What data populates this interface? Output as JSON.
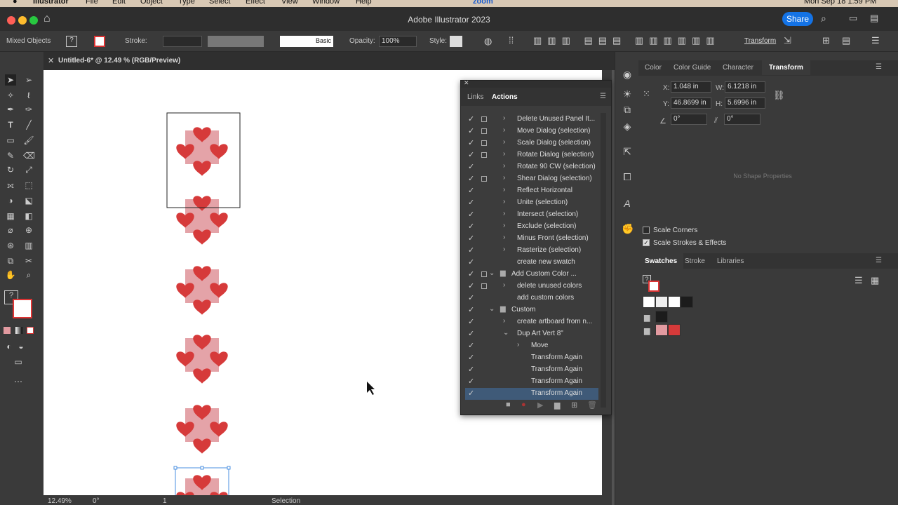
{
  "menubar": {
    "app": "Illustrator",
    "items": [
      "File",
      "Edit",
      "Object",
      "Type",
      "Select",
      "Effect",
      "View",
      "Window",
      "Help"
    ],
    "clock": "Mon Sep 18  1:59 PM",
    "zoom_app": "zoom"
  },
  "window": {
    "title": "Adobe Illustrator 2023",
    "share": "Share"
  },
  "control": {
    "selection": "Mixed Objects",
    "stroke_label": "Stroke:",
    "brush": "Basic",
    "opacity_label": "Opacity:",
    "opacity": "100%",
    "style_label": "Style:",
    "transform": "Transform"
  },
  "document": {
    "tab": "Untitled-6* @ 12.49 % (RGB/Preview)"
  },
  "status": {
    "zoom": "12.49%",
    "rotation": "0°",
    "artboard": "1",
    "tool": "Selection"
  },
  "actions_panel": {
    "tabs": [
      "Links",
      "Actions"
    ],
    "rows": [
      {
        "label": "Delete Unused Panel It...",
        "box": true,
        "indent": 1,
        "arrow": "›"
      },
      {
        "label": "Move Dialog (selection)",
        "box": true,
        "indent": 1,
        "arrow": "›"
      },
      {
        "label": "Scale Dialog (selection)",
        "box": true,
        "indent": 1,
        "arrow": "›"
      },
      {
        "label": "Rotate Dialog (selection)",
        "box": true,
        "indent": 1,
        "arrow": "›"
      },
      {
        "label": "Rotate 90 CW (selection)",
        "box": false,
        "indent": 1,
        "arrow": "›"
      },
      {
        "label": "Shear Dialog (selection)",
        "box": true,
        "indent": 1,
        "arrow": "›"
      },
      {
        "label": "Reflect Horizontal",
        "box": false,
        "indent": 1,
        "arrow": "›"
      },
      {
        "label": "Unite (selection)",
        "box": false,
        "indent": 1,
        "arrow": "›"
      },
      {
        "label": "Intersect (selection)",
        "box": false,
        "indent": 1,
        "arrow": "›"
      },
      {
        "label": "Exclude (selection)",
        "box": false,
        "indent": 1,
        "arrow": "›"
      },
      {
        "label": "Minus Front (selection)",
        "box": false,
        "indent": 1,
        "arrow": "›"
      },
      {
        "label": "Rasterize (selection)",
        "box": false,
        "indent": 1,
        "arrow": "›"
      },
      {
        "label": "create new swatch",
        "box": false,
        "indent": 1,
        "arrow": ""
      },
      {
        "label": "Add Custom Color ...",
        "box": true,
        "indent": 0,
        "arrow": "⌄",
        "folder": true
      },
      {
        "label": "delete unused colors",
        "box": true,
        "indent": 1,
        "arrow": "›"
      },
      {
        "label": "add custom colors",
        "box": false,
        "indent": 1,
        "arrow": ""
      },
      {
        "label": "Custom",
        "box": false,
        "indent": 0,
        "arrow": "⌄",
        "folder": true
      },
      {
        "label": "create artboard from n...",
        "box": false,
        "indent": 1,
        "arrow": "›"
      },
      {
        "label": "Dup Art Vert 8\"",
        "box": false,
        "indent": 1,
        "arrow": "⌄"
      },
      {
        "label": "Move",
        "box": false,
        "indent": 2,
        "arrow": "›"
      },
      {
        "label": "Transform Again",
        "box": false,
        "indent": 2,
        "arrow": ""
      },
      {
        "label": "Transform Again",
        "box": false,
        "indent": 2,
        "arrow": ""
      },
      {
        "label": "Transform Again",
        "box": false,
        "indent": 2,
        "arrow": ""
      },
      {
        "label": "Transform Again",
        "box": false,
        "indent": 2,
        "arrow": "",
        "selected": true
      }
    ]
  },
  "panel_tabs_top": [
    "Color",
    "Color Guide",
    "Character",
    "Transform"
  ],
  "transform": {
    "x_label": "X:",
    "x": "1.048 in",
    "y_label": "Y:",
    "y": "46.8699 in",
    "w_label": "W:",
    "w": "6.1218 in",
    "h_label": "H:",
    "h": "5.6996 in",
    "angle": "0°",
    "shear": "0°",
    "no_shape": "No Shape Properties",
    "scale_corners": "Scale Corners",
    "scale_strokes": "Scale Strokes & Effects"
  },
  "panel_tabs_bottom": [
    "Swatches",
    "Stroke",
    "Libraries"
  ],
  "colors": {
    "heart": "#d63a3a",
    "square": "#e4a3a8",
    "accent": "#1473e6",
    "swatch_pink": "#e29aa0",
    "swatch_red": "#d63a3a",
    "swatch_black": "#1c1c1c"
  }
}
